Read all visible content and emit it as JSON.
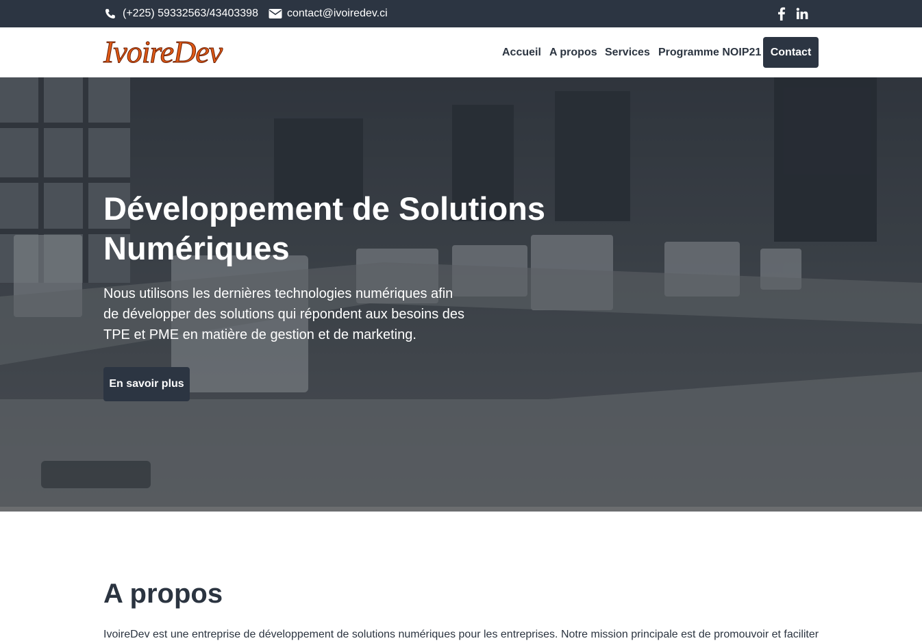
{
  "topbar": {
    "phone": "(+225) 59332563/43403398",
    "email": "contact@ivoiredev.ci",
    "icons": [
      "phone-icon",
      "envelope-icon",
      "facebook-icon",
      "linkedin-icon"
    ]
  },
  "navbar": {
    "logo_text": "IvoireDev",
    "links": {
      "accueil": "Accueil",
      "apropos": "A propos",
      "services": "Services",
      "noip": "Programme NOIP21",
      "contact": "Contact"
    }
  },
  "hero": {
    "title": "Développement de Solutions Numériques",
    "subtitle": "Nous utilisons les dernières technologies numériques afin de développer des solutions qui répondent aux besoins des TPE et PME en matière de gestion et de marketing.",
    "button": "En savoir plus"
  },
  "about": {
    "title": "A propos",
    "text": "IvoireDev est une entreprise de développement de solutions numériques pour les entreprises. Notre mission principale est de promouvoir et faciliter"
  },
  "colors": {
    "dark": "#2c3542",
    "logo_orange": "#e05a16",
    "white": "#ffffff"
  }
}
